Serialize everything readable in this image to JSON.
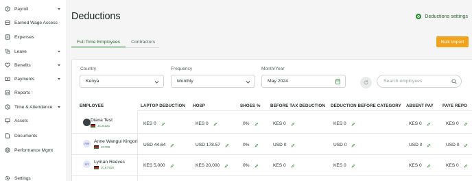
{
  "sidebar": {
    "items": [
      {
        "label": "Payroll",
        "icon": "payroll-icon",
        "chevron": true
      },
      {
        "label": "Earned Wage Access",
        "icon": "wage-access-icon",
        "chevron": false
      },
      {
        "label": "Expenses",
        "icon": "expenses-icon",
        "chevron": false
      },
      {
        "label": "Leave",
        "icon": "leave-icon",
        "chevron": true
      },
      {
        "label": "Benefits",
        "icon": "benefits-icon",
        "chevron": true
      },
      {
        "label": "Payments",
        "icon": "payments-icon",
        "chevron": true
      },
      {
        "label": "Reports",
        "icon": "reports-icon",
        "chevron": false
      },
      {
        "label": "Time & Attendance",
        "icon": "clock-icon",
        "chevron": true
      },
      {
        "label": "Assets",
        "icon": "assets-icon",
        "chevron": false
      },
      {
        "label": "Documents",
        "icon": "documents-icon",
        "chevron": false
      },
      {
        "label": "Performance Mgmt",
        "icon": "performance-icon",
        "chevron": false
      },
      {
        "label": "Settings",
        "icon": "gear-icon",
        "chevron": false
      }
    ]
  },
  "header": {
    "title": "Deductions",
    "settings_label": "Deductions settings"
  },
  "tabs": [
    {
      "label": "Full Time Employees",
      "active": true
    },
    {
      "label": "Contractors",
      "active": false
    }
  ],
  "bulk_import_label": "Bulk Import",
  "filters": {
    "country": {
      "label": "Country",
      "value": "Kenya"
    },
    "frequency": {
      "label": "Frequency",
      "value": "Monthly"
    },
    "month": {
      "label": "Month/Year",
      "value": "May 2024"
    },
    "search_placeholder": "Search employees"
  },
  "table": {
    "columns": [
      "EMPLOYEE",
      "LAPTOP DEDUCTION",
      "HOSP",
      "SHOES %",
      "BEFORE TAX DEDUCTION",
      "DEDUCTION BEFORE CATEGORY",
      "ABSENT PAY",
      "PAYE REPO"
    ],
    "rows": [
      {
        "name": "Diana Test",
        "id": "JCJ4321",
        "avatar": "",
        "cells": [
          "KES 0",
          "KES 0",
          "0%",
          "KES 0",
          "KES 0",
          "KES 0",
          "KES 0"
        ]
      },
      {
        "name": "Anne Wangui Kingori",
        "id": "JC789",
        "avatar": "AW",
        "cells": [
          "USD 44.64",
          "USD 178.57",
          "0%",
          "USD 0",
          "USD 0",
          "USD 0",
          "USD 0"
        ]
      },
      {
        "name": "Lyman Reeves",
        "id": "JCK7918",
        "avatar": "LR",
        "cells": [
          "KES 5,000",
          "KES 20,000",
          "0%",
          "KES 0",
          "KES 0",
          "KES 0",
          "KES 0"
        ]
      }
    ]
  },
  "colors": {
    "accent_green": "#3a8a3f",
    "bulk_import": "#f0a31d",
    "id_green": "#3f8a44"
  }
}
